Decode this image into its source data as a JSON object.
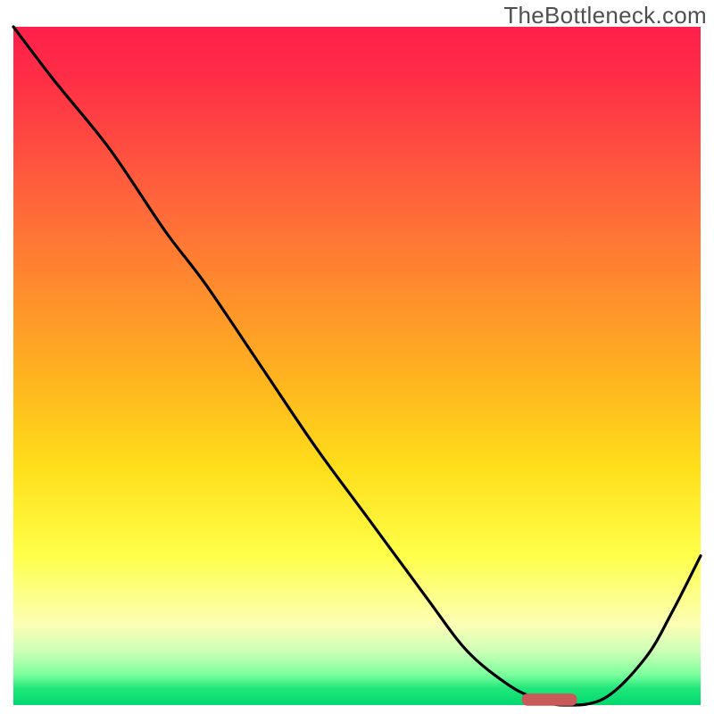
{
  "watermark": "TheBottleneck.com",
  "chart_data": {
    "type": "line",
    "title": "",
    "xlabel": "",
    "ylabel": "",
    "xlim": [
      0,
      100
    ],
    "ylim": [
      0,
      100
    ],
    "series": [
      {
        "name": "bottleneck-curve",
        "x": [
          0,
          6,
          14,
          22,
          28,
          36,
          44,
          52,
          60,
          66,
          72,
          76,
          80,
          86,
          92,
          96,
          100
        ],
        "y": [
          100,
          92,
          82,
          70,
          62,
          50,
          38,
          27,
          16,
          8,
          3,
          1,
          0,
          1,
          7,
          14,
          22
        ]
      }
    ],
    "marker": {
      "x_start": 74,
      "x_end": 82,
      "y": 0.8
    },
    "background_gradient": [
      {
        "stop": 0,
        "color": "#ff1f4b"
      },
      {
        "stop": 8,
        "color": "#ff2f46"
      },
      {
        "stop": 22,
        "color": "#ff5a3e"
      },
      {
        "stop": 38,
        "color": "#ff8a2e"
      },
      {
        "stop": 52,
        "color": "#ffb41f"
      },
      {
        "stop": 65,
        "color": "#ffde1a"
      },
      {
        "stop": 78,
        "color": "#ffff4a"
      },
      {
        "stop": 88,
        "color": "#fcffb4"
      },
      {
        "stop": 92,
        "color": "#cfffb8"
      },
      {
        "stop": 95.5,
        "color": "#7cff9d"
      },
      {
        "stop": 97.5,
        "color": "#22e77a"
      },
      {
        "stop": 100,
        "color": "#00d86f"
      }
    ]
  }
}
